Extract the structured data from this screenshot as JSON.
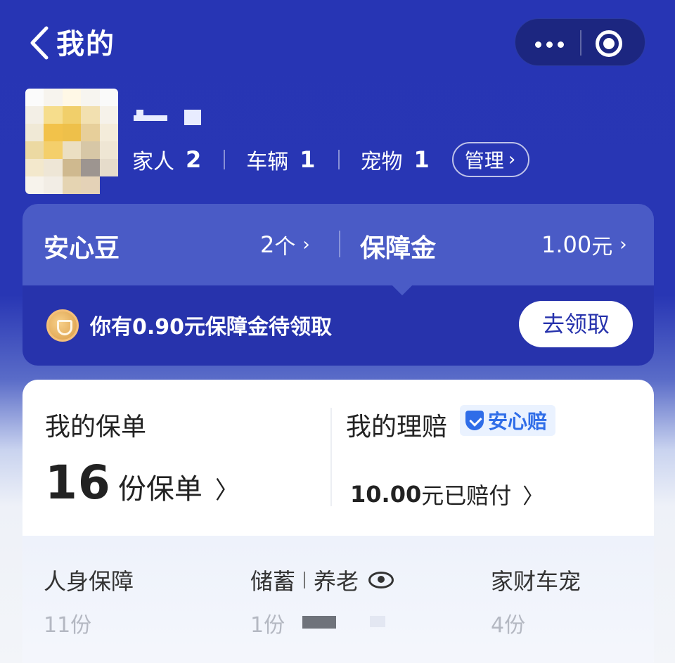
{
  "header": {
    "back_label": "返回",
    "title": "我的"
  },
  "profile": {
    "stats": [
      {
        "label": "家人",
        "count": "2"
      },
      {
        "label": "车辆",
        "count": "1"
      },
      {
        "label": "宠物",
        "count": "1"
      }
    ],
    "manage_label": "管理"
  },
  "assets": {
    "beans_label": "安心豆",
    "beans_value": "2",
    "beans_unit": "个",
    "fund_label": "保障金",
    "fund_value": "1.00",
    "fund_unit": "元",
    "notice": "你有0.90元保障金待领取",
    "claim_button": "去领取"
  },
  "policies": {
    "title": "我的保单",
    "count": "16",
    "count_unit": "份保单"
  },
  "claims": {
    "title": "我的理赔",
    "badge": "安心赔",
    "amount": "10.00",
    "amount_suffix": "元已赔付"
  },
  "categories": [
    {
      "name": "人身保障",
      "count": "11份"
    },
    {
      "name_a": "储蓄",
      "name_b": "养老",
      "count": "1份"
    },
    {
      "name": "家财车宠",
      "count": "4份"
    }
  ],
  "colors": {
    "brand_blue": "#2733ac",
    "accent_blue": "#2f6de8"
  }
}
